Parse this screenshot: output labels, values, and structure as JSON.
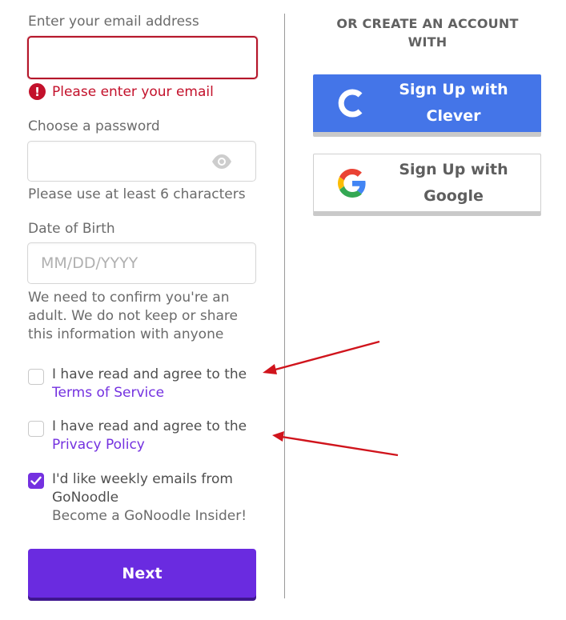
{
  "email": {
    "label": "Enter your email address",
    "value": "",
    "error": "Please enter your email"
  },
  "password": {
    "label": "Choose a password",
    "value": "",
    "hint": "Please use at least 6 characters",
    "icon": "eye-icon"
  },
  "dob": {
    "label": "Date of Birth",
    "placeholder": "MM/DD/YYYY",
    "hint_lines": [
      "We need to confirm you're an",
      "adult. We do not keep or share",
      "this information with anyone"
    ]
  },
  "agreements": {
    "terms": {
      "text": "I have read and agree to the",
      "link": "Terms of Service",
      "checked": false
    },
    "privacy": {
      "text": "I have read and agree to the",
      "link": "Privacy Policy",
      "checked": false
    },
    "newsletter": {
      "line1": "I'd like weekly emails from",
      "line2": "GoNoodle",
      "sub": "Become a GoNoodle Insider!",
      "checked": true
    }
  },
  "next_button": {
    "label": "Next"
  },
  "social": {
    "heading_line1": "OR CREATE AN ACCOUNT",
    "heading_line2": "WITH",
    "clever": {
      "line1": "Sign Up with",
      "line2": "Clever",
      "color": "#4475e8"
    },
    "google": {
      "line1": "Sign Up with",
      "line2": "Google"
    }
  },
  "colors": {
    "accent": "#6a2be0",
    "error": "#c3112b",
    "annotation_arrow": "#d0141c"
  }
}
